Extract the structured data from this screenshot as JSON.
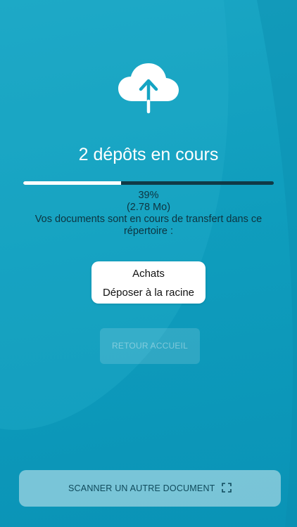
{
  "upload": {
    "title": "2 dépôts en cours",
    "progress_text": "39%",
    "progress_fraction": 0.39,
    "size_text": "(2.78 Mo)",
    "message": "Vos documents sont en cours de transfert dans ce répertoire :"
  },
  "folders": {
    "items": [
      "Achats",
      "Déposer à la racine"
    ]
  },
  "buttons": {
    "home_label": "RETOUR ACCUEIL",
    "scan_label": "SCANNER UN AUTRE DOCUMENT"
  },
  "icons": {
    "upload": "cloud-upload-icon",
    "scan": "scan-frame-icon"
  },
  "colors": {
    "background": "#0f9dbd",
    "progress_track": "#103a46",
    "progress_fill": "#ffffff",
    "text_dark": "#0d3440"
  }
}
